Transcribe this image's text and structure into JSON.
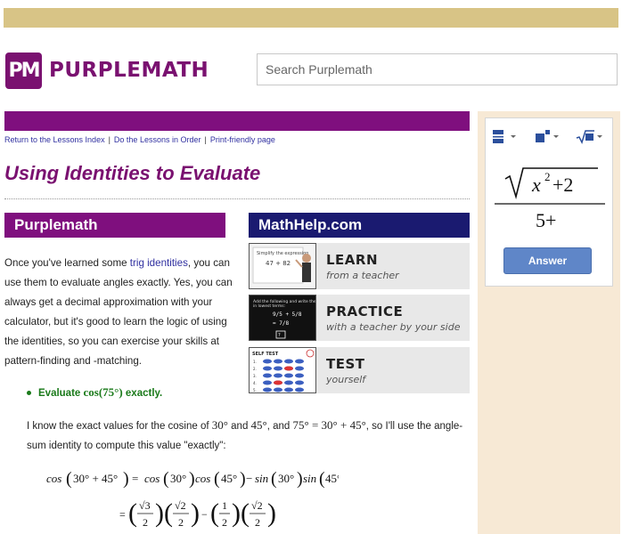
{
  "header": {
    "logo_mark": "PM",
    "logo_text": "PURPLEMATH",
    "search_placeholder": "Search Purplemath"
  },
  "breadcrumbs": [
    "Return to the Lessons Index",
    "Do the Lessons in Order",
    "Print-friendly page"
  ],
  "page_title": "Using Identities to Evaluate",
  "purplemath_box_title": "Purplemath",
  "intro": {
    "before_link": "Once you've learned some ",
    "link": "trig identities",
    "after_link": ", you can use them to evaluate angles exactly. Yes, you can always get a decimal approximation with your calculator, but it's good to learn the logic of using the identities, so you can exercise your skills at pattern-finding and -matching."
  },
  "mathhelp": {
    "title": "MathHelp.com",
    "items": [
      {
        "heading": "LEARN",
        "sub": "from a teacher"
      },
      {
        "heading": "PRACTICE",
        "sub": "with a teacher by your side"
      },
      {
        "heading": "TEST",
        "sub": "yourself"
      }
    ]
  },
  "exercise": {
    "lead": "Evaluate",
    "expr": "cos(75°)",
    "tail": "exactly."
  },
  "explanation": {
    "p1": "I know the exact values for the cosine of ",
    "v30": "30°",
    "and": " and ",
    "v45": "45°",
    "comma_and": ", and ",
    "eq": "75° = 30° + 45°",
    "p2": ", so I'll use the angle-sum identity to compute this value \"exactly\":"
  },
  "widget": {
    "answer_label": "Answer"
  },
  "colors": {
    "brand_purple": "#7f0f7e",
    "mathhelp_navy": "#1a1a70",
    "exercise_green": "#1a7a1a",
    "link_blue": "#3030a0",
    "sidebar_tan": "#f7e9d5"
  }
}
